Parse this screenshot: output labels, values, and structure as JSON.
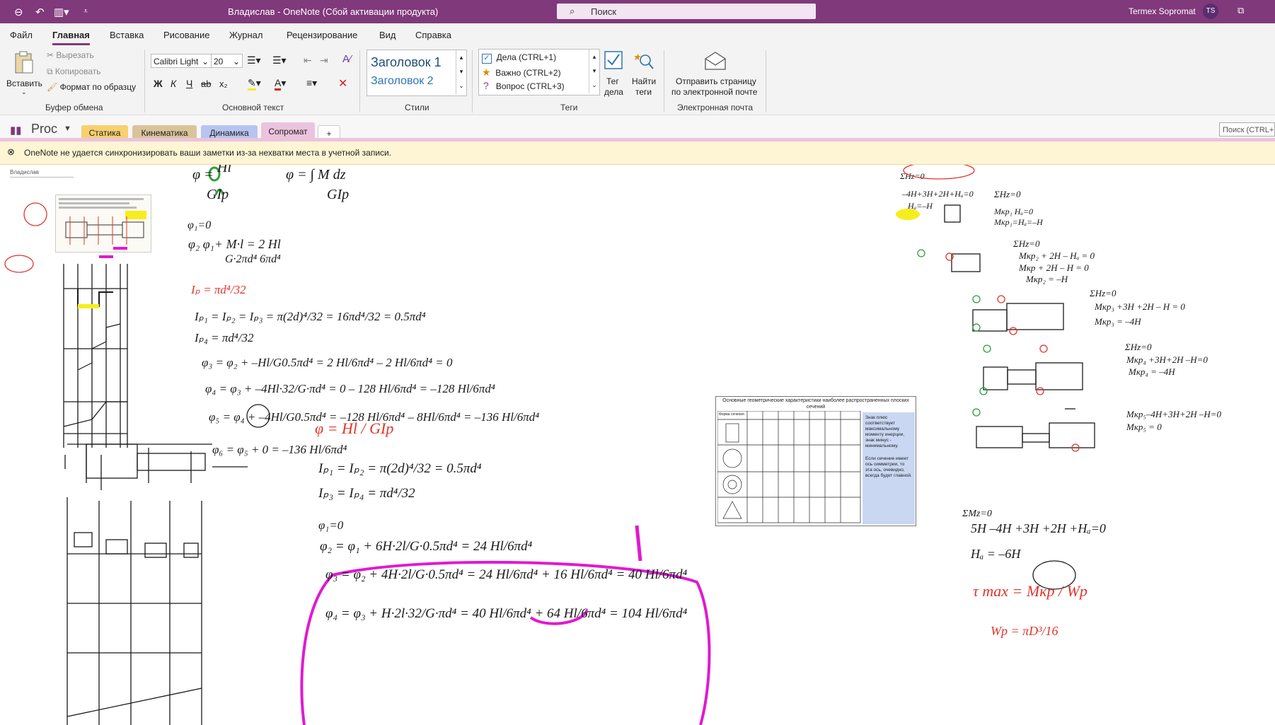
{
  "window": {
    "title": "Владислав  -  OneNote (Сбой активации продукта)",
    "search_placeholder": "Поиск",
    "user_name": "Termex Sopromat",
    "user_initials": "TS"
  },
  "menu": [
    "Файл",
    "Главная",
    "Вставка",
    "Рисование",
    "Журнал",
    "Рецензирование",
    "Вид",
    "Справка"
  ],
  "ribbon": {
    "clipboard": {
      "paste": "Вставить",
      "cut": "Вырезать",
      "copy": "Копировать",
      "format_painter": "Формат по образцу",
      "label": "Буфер обмена"
    },
    "text": {
      "font": "Calibri Light",
      "size": "20",
      "bold": "Ж",
      "italic": "К",
      "underline": "Ч",
      "strike": "ab",
      "subscript": "x₂",
      "label": "Основной текст"
    },
    "styles": {
      "h1": "Заголовок 1",
      "h2": "Заголовок 2",
      "label": "Стили"
    },
    "tags": {
      "todo": "Дела (CTRL+1)",
      "important": "Важно (CTRL+2)",
      "question": "Вопрос (CTRL+3)",
      "tag_todo_1": "Тег",
      "tag_todo_2": "дела",
      "find_tags_1": "Найти",
      "find_tags_2": "теги",
      "label": "Теги"
    },
    "email": {
      "send_1": "Отправить страницу",
      "send_2": "по электронной почте",
      "label": "Электронная почта"
    }
  },
  "notebook": {
    "name": "Proc",
    "sections": [
      "Статика",
      "Кинематика",
      "Динамика",
      "Сопромат"
    ],
    "add": "+",
    "search_page": "Поиск (CTRL+E)"
  },
  "warning": "OneNote не удается синхронизировать ваши заметки из-за нехватки места в учетной записи.",
  "page": {
    "author": "Владислав",
    "ref_table_title": "Основные геометрические характеристики наиболее распространенных плоских сечений",
    "ref_table_col": "Форма сечения",
    "ref_table_note_1": "Знак плюс соответствует максимальному моменту инерции, знак минус - минимальному.",
    "ref_table_note_2": "Если сечение имеет ось симметрии, то эта ось, очевидно, всегда будет главной."
  },
  "colors": {
    "accent": "#80397b",
    "ink_black": "#1a1a1a",
    "ink_red": "#e0352b",
    "ink_green": "#2e9e3a",
    "ink_magenta": "#e01ad0",
    "highlight_yellow": "#f6ee1c",
    "warning_bg": "#fdf5d4"
  }
}
